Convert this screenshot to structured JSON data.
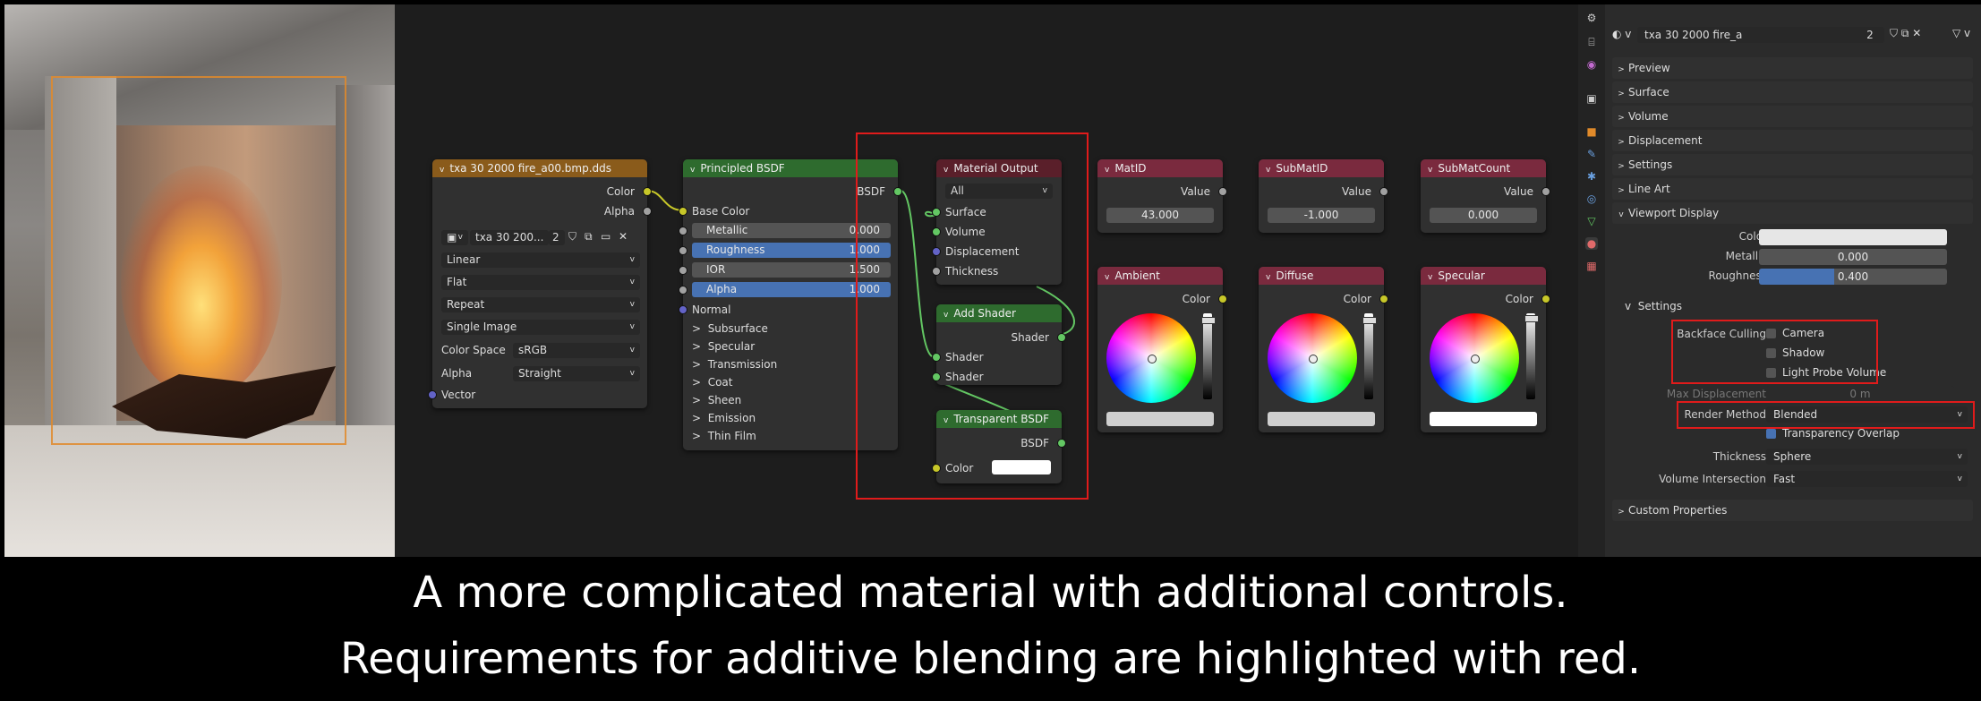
{
  "image_node": {
    "header": "txa 30 2000 fire_a00.bmp.dds",
    "header_color": "#8a5b1b",
    "outputs": [
      "Color",
      "Alpha"
    ],
    "image_name": "txa 30 200...",
    "users": "2",
    "interpolation": "Linear",
    "projection": "Flat",
    "extension": "Repeat",
    "source": "Single Image",
    "color_space_label": "Color Space",
    "color_space": "sRGB",
    "alpha_label": "Alpha",
    "alpha_mode": "Straight",
    "input_vector": "Vector"
  },
  "principled": {
    "header": "Principled BSDF",
    "header_color": "#2e6b2e",
    "output": "BSDF",
    "base_color": "Base Color",
    "fields": [
      {
        "label": "Metallic",
        "value": "0.000",
        "blue": false
      },
      {
        "label": "Roughness",
        "value": "1.000",
        "blue": true
      },
      {
        "label": "IOR",
        "value": "1.500",
        "blue": false
      },
      {
        "label": "Alpha",
        "value": "1.000",
        "blue": true
      }
    ],
    "normal": "Normal",
    "panels": [
      "Subsurface",
      "Specular",
      "Transmission",
      "Coat",
      "Sheen",
      "Emission",
      "Thin Film"
    ]
  },
  "material_output": {
    "header": "Material Output",
    "header_color": "#5a1f2a",
    "target": "All",
    "inputs": [
      "Surface",
      "Volume",
      "Displacement",
      "Thickness"
    ]
  },
  "add_shader": {
    "header": "Add Shader",
    "header_color": "#2e6b2e",
    "output": "Shader",
    "inputs": [
      "Shader",
      "Shader"
    ]
  },
  "transparent": {
    "header": "Transparent BSDF",
    "header_color": "#2e6b2e",
    "output": "BSDF",
    "input": "Color",
    "color_value": "#ffffff"
  },
  "value_nodes": [
    {
      "header": "MatID",
      "output": "Value",
      "value": "43.000"
    },
    {
      "header": "SubMatID",
      "output": "Value",
      "value": "-1.000"
    },
    {
      "header": "SubMatCount",
      "output": "Value",
      "value": "0.000"
    }
  ],
  "color_nodes": [
    {
      "header": "Ambient",
      "output": "Color",
      "swatch": "#cfcfcf"
    },
    {
      "header": "Diffuse",
      "output": "Color",
      "swatch": "#cfcfcf"
    },
    {
      "header": "Specular",
      "output": "Color",
      "swatch": "#ffffff"
    }
  ],
  "props": {
    "material_name": "txa 30 2000 fire_a",
    "users": "2",
    "panels_top": [
      "Preview",
      "Surface",
      "Volume",
      "Displacement",
      "Settings",
      "Line Art"
    ],
    "viewport_display": "Viewport Display",
    "color_label": "Color",
    "metallic_label": "Metallic",
    "metallic": "0.000",
    "roughness_label": "Roughness",
    "roughness": "0.400",
    "roughness_fraction": 0.4,
    "settings": "Settings",
    "backface_label": "Backface Culling",
    "backface_options": [
      "Camera",
      "Shadow",
      "Light Probe Volume"
    ],
    "max_disp_label": "Max Displacement",
    "max_disp": "0 m",
    "render_method_label": "Render Method",
    "render_method": "Blended",
    "transparency_overlap": "Transparency Overlap",
    "thickness_label": "Thickness",
    "thickness": "Sphere",
    "volume_label": "Volume Intersection",
    "volume": "Fast",
    "custom": "Custom Properties"
  },
  "caption": {
    "line1": "A more complicated material with additional controls.",
    "line2": "Requirements for additive blending are highlighted with red."
  },
  "colors": {
    "highlight": "#e01b1b",
    "value_header": "#7a2a3e",
    "blue": "#4772b3"
  }
}
